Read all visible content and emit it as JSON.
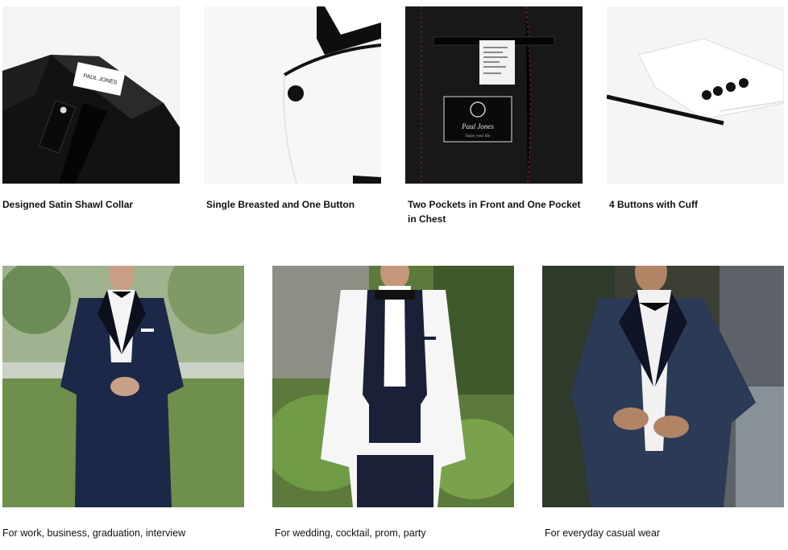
{
  "features": [
    {
      "caption": "Designed Satin Shawl Collar",
      "image": "black-shawl-collar-with-tag",
      "tag_brand": "PAUL JONES"
    },
    {
      "caption": "Single Breasted and One Button",
      "image": "white-jacket-one-button"
    },
    {
      "caption": "Two Pockets in Front and One Pocket in Chest",
      "image": "inner-lining-pocket-with-label",
      "label_brand": "Paul Jones",
      "label_tagline": "Enjoy your life"
    },
    {
      "caption": "4 Buttons with Cuff",
      "image": "white-sleeve-cuff-buttons"
    }
  ],
  "occasions": [
    {
      "caption": "For work, business, graduation, interview",
      "image": "man-in-navy-tuxedo-outdoors"
    },
    {
      "caption": "For wedding, cocktail, prom, party",
      "image": "man-in-white-tuxedo-jacket"
    },
    {
      "caption": "For everyday casual wear",
      "image": "man-in-dark-blue-tuxedo"
    }
  ],
  "colors": {
    "background": "#ffffff",
    "black_satin": "#0d0d0d",
    "white_jacket": "#f5f5f5",
    "navy": "#1b2745",
    "foliage": "#5a7a3a"
  }
}
